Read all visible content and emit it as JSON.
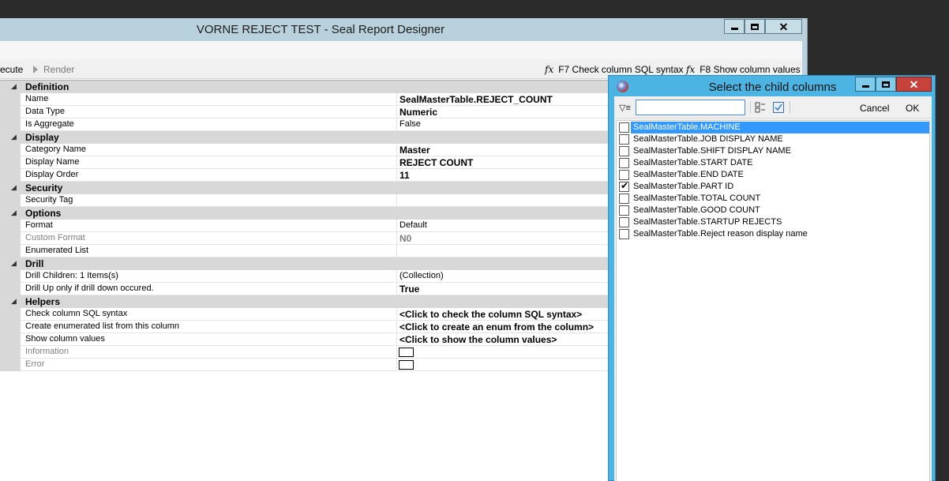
{
  "main_window": {
    "title": "VORNE REJECT TEST - Seal Report Designer",
    "toolbar": {
      "execute_label": "ecute",
      "render_label": "Render",
      "check_sql_label": "F7 Check column SQL syntax",
      "show_values_label": "F8 Show column values"
    }
  },
  "property_grid": {
    "categories": [
      {
        "label": "Definition",
        "props": [
          {
            "name": "Name",
            "value": "SealMasterTable.REJECT_COUNT",
            "bold": true
          },
          {
            "name": "Data Type",
            "value": "Numeric",
            "bold": true
          },
          {
            "name": "Is Aggregate",
            "value": "False",
            "bold": false
          }
        ]
      },
      {
        "label": "Display",
        "props": [
          {
            "name": "Category Name",
            "value": "Master",
            "bold": true
          },
          {
            "name": "Display Name",
            "value": "REJECT COUNT",
            "bold": true
          },
          {
            "name": "Display Order",
            "value": "11",
            "bold": true
          }
        ]
      },
      {
        "label": "Security",
        "props": [
          {
            "name": "Security Tag",
            "value": "",
            "bold": false
          }
        ]
      },
      {
        "label": "Options",
        "props": [
          {
            "name": "Format",
            "value": "Default",
            "bold": false
          },
          {
            "name": "Custom Format",
            "value": "N0",
            "bold": true,
            "muted": true
          },
          {
            "name": "Enumerated List",
            "value": "",
            "bold": false
          }
        ]
      },
      {
        "label": "Drill",
        "props": [
          {
            "name": "Drill Children: 1 Items(s)",
            "value": "(Collection)",
            "bold": false
          },
          {
            "name": "Drill Up only if drill down occured.",
            "value": "True",
            "bold": true
          }
        ]
      },
      {
        "label": "Helpers",
        "props": [
          {
            "name": "Check column SQL syntax",
            "value": "<Click to check the column SQL syntax>",
            "bold": true
          },
          {
            "name": "Create enumerated list from this column",
            "value": "<Click to create an enum from the column>",
            "bold": true
          },
          {
            "name": "Show column values",
            "value": "<Click to show the column values>",
            "bold": true
          },
          {
            "name": "Information",
            "value": "",
            "muted": true,
            "box": true
          },
          {
            "name": "Error",
            "value": "",
            "muted": true,
            "box": true
          }
        ]
      }
    ]
  },
  "dialog": {
    "title": "Select the child columns",
    "filter_value": "",
    "cancel_label": "Cancel",
    "ok_label": "OK",
    "columns": [
      {
        "label": "SealMasterTable.MACHINE",
        "checked": false,
        "selected": true
      },
      {
        "label": "SealMasterTable.JOB DISPLAY NAME",
        "checked": false,
        "selected": false
      },
      {
        "label": "SealMasterTable.SHIFT DISPLAY NAME",
        "checked": false,
        "selected": false
      },
      {
        "label": "SealMasterTable.START DATE",
        "checked": false,
        "selected": false
      },
      {
        "label": "SealMasterTable.END DATE",
        "checked": false,
        "selected": false
      },
      {
        "label": "SealMasterTable.PART ID",
        "checked": true,
        "selected": false
      },
      {
        "label": "SealMasterTable.TOTAL COUNT",
        "checked": false,
        "selected": false
      },
      {
        "label": "SealMasterTable.GOOD COUNT",
        "checked": false,
        "selected": false
      },
      {
        "label": "SealMasterTable.STARTUP REJECTS",
        "checked": false,
        "selected": false
      },
      {
        "label": "SealMasterTable.Reject reason display name",
        "checked": false,
        "selected": false
      }
    ]
  }
}
